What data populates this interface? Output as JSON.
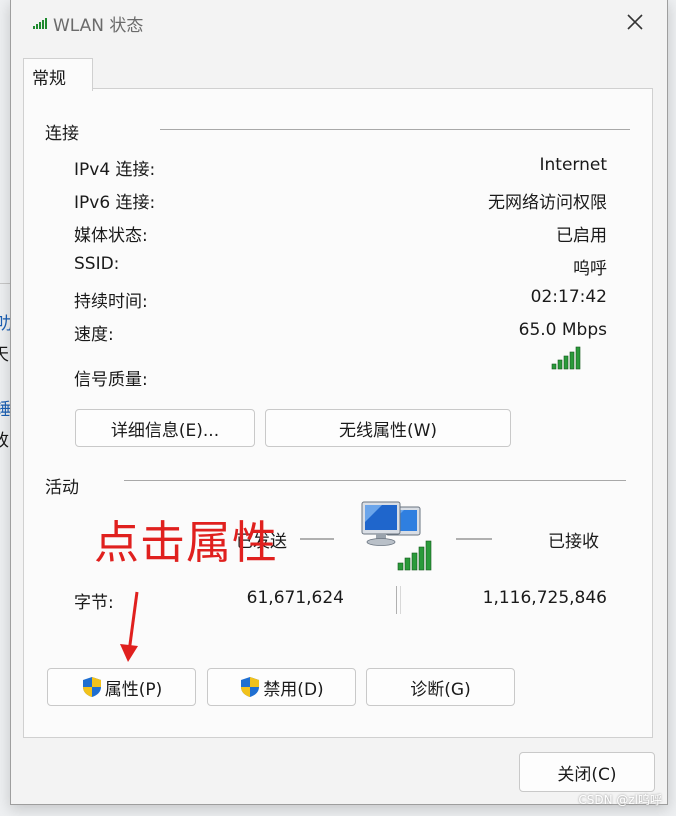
{
  "window": {
    "title": "WLAN 状态",
    "tab_label": "常规"
  },
  "connection": {
    "section_title": "连接",
    "rows": [
      {
        "label": "IPv4 连接:",
        "value": "Internet"
      },
      {
        "label": "IPv6 连接:",
        "value": "无网络访问权限"
      },
      {
        "label": "媒体状态:",
        "value": "已启用"
      },
      {
        "label": "SSID:",
        "value": "呜呼"
      },
      {
        "label": "持续时间:",
        "value": "02:17:42"
      },
      {
        "label": "速度:",
        "value": "65.0 Mbps"
      }
    ],
    "signal_label": "信号质量:",
    "signal_bars": 5,
    "signal_bars_total": 5,
    "details_button": "详细信息(E)...",
    "wireless_props_button": "无线属性(W)"
  },
  "activity": {
    "section_title": "活动",
    "sent_label": "已发送",
    "received_label": "已接收",
    "bytes_label": "字节:",
    "bytes_sent": "61,671,624",
    "bytes_received": "1,116,725,846",
    "properties_button": "属性(P)",
    "disable_button": "禁用(D)",
    "diagnose_button": "诊断(G)"
  },
  "footer": {
    "close_button": "关闭(C)"
  },
  "annotation": {
    "text": "点击属性",
    "color": "#e0201e"
  },
  "background_fragments": [
    "叻",
    "天、",
    "锤",
    "改"
  ],
  "watermark": "CSDN @zl呜呼",
  "colors": {
    "signal_green": "#1e8a2e",
    "shield_blue": "#1f6fd1",
    "shield_yellow": "#f2c21b"
  }
}
